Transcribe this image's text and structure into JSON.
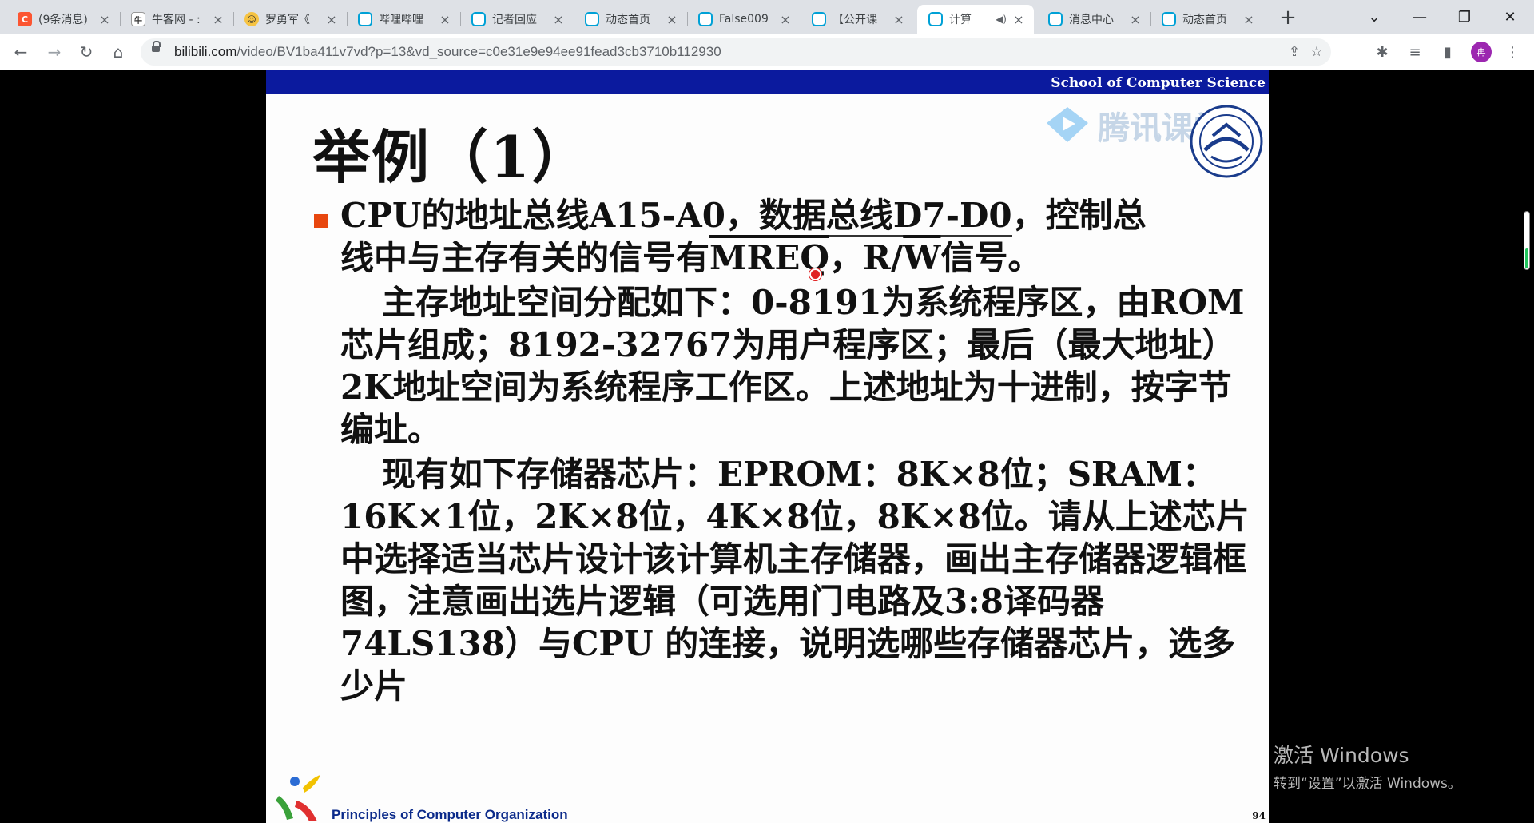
{
  "tabs": [
    {
      "title": "(9条消息)",
      "favicon": "csdn"
    },
    {
      "title": "牛客网 - :",
      "favicon": "nowcoder"
    },
    {
      "title": "罗勇军《",
      "favicon": "face"
    },
    {
      "title": "哔哩哔哩",
      "favicon": "bilibili"
    },
    {
      "title": "记者回应",
      "favicon": "bilibili"
    },
    {
      "title": "动态首页",
      "favicon": "bilibili"
    },
    {
      "title": "False009",
      "favicon": "bilibili"
    },
    {
      "title": "【公开课",
      "favicon": "bilibili"
    },
    {
      "title": "计算",
      "favicon": "bilibili",
      "active": true,
      "audio": true
    },
    {
      "title": "消息中心",
      "favicon": "bilibili"
    },
    {
      "title": "动态首页",
      "favicon": "bilibili"
    }
  ],
  "address": {
    "host": "bilibili.com",
    "path": "/video/BV1ba411v7vd?p=13&vd_source=c0e31e9e94ee91fead3cb3710b112930"
  },
  "profile": {
    "initial": "冉"
  },
  "slide": {
    "header": "School of Computer Science",
    "title": "举例（1）",
    "watermark": "腾讯课堂",
    "line1a": "CPU的地址总线A15-A0，",
    "line1b": "数据总线D7-D0",
    "line1c": "，控制总",
    "line2a": "线中与主存有关的信号有",
    "line2b": "MREQ",
    "line2c": "，R/",
    "line2d": "W",
    "line2e": "信号。",
    "p2": "主存地址空间分配如下：0-8191为系统程序区，由ROM芯片组成；8192-32767为用户程序区；最后（最大地址）2K地址空间为系统程序工作区。上述地址为十进制，按字节编址。",
    "p3": "现有如下存储器芯片：EPROM：8K×8位；SRAM：16K×1位，2K×8位，4K×8位，8K×8位。请从上述芯片中选择适当芯片设计该计算机主存储器，画出主存储器逻辑框图，注意画出选片逻辑（可选用门电路及3:8译码器74LS138）与CPU 的连接，说明选哪些存储器芯片，选多少片",
    "footer": "Principles of Computer Organization",
    "page": "94"
  },
  "activation": {
    "line1": "激活 Windows",
    "line2": "转到“设置”以激活 Windows。"
  },
  "colors": {
    "header_blue": "#0b1a9e",
    "bullet": "#e8470f",
    "bilibili": "#00a1d6",
    "progress": "#22c55e"
  },
  "scroll_indicator_fill": 0.35
}
